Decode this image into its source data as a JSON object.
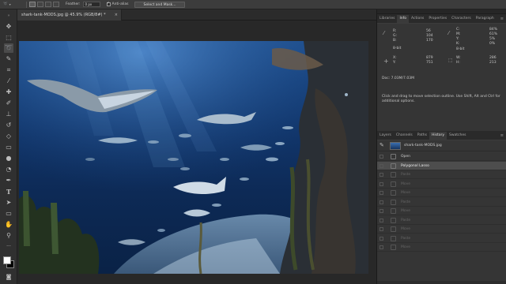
{
  "options_bar": {
    "feather_label": "Feather:",
    "feather_value": "0 px",
    "antialias_label": "Anti-alias",
    "select_mask_label": "Select and Mask..."
  },
  "document": {
    "tab_title": "shark-tank-MODS.jpg @ 45.9% (RGB/8#) *",
    "close_glyph": "×"
  },
  "info_panel": {
    "tabs": [
      "Libraries",
      "Info",
      "Actions",
      "Properties",
      "Characters",
      "Paragraph"
    ],
    "menu_glyph": "≡",
    "rgb_labels": [
      "R:",
      "G:",
      "B:"
    ],
    "rgb_values": [
      "56",
      "104",
      "170"
    ],
    "cmyk_labels": [
      "C:",
      "M:",
      "Y:",
      "K:"
    ],
    "cmyk_values": [
      "84%",
      "61%",
      "5%",
      "0%"
    ],
    "bit_depth_left": "8-bit",
    "bit_depth_right": "8-bit",
    "xy_labels": [
      "X:",
      "Y:"
    ],
    "xy_values": [
      "879",
      "751"
    ],
    "wh_labels": [
      "W:",
      "H:"
    ],
    "wh_values": [
      "286",
      "213"
    ],
    "doc_size": "Doc: 7.03M/7.03M",
    "hint": "Click and drag to move selection outline. Use Shift, Alt and Ctrl for additional options."
  },
  "history_panel": {
    "tabs": [
      "Layers",
      "Channels",
      "Paths",
      "History",
      "Swatches"
    ],
    "menu_glyph": "≡",
    "snapshot_name": "shark-tank-MODS.jpg",
    "states": [
      {
        "label": "Open",
        "status": "normal"
      },
      {
        "label": "Polygonal Lasso",
        "status": "current"
      },
      {
        "label": "Paste",
        "status": "undone"
      },
      {
        "label": "Move",
        "status": "undone"
      },
      {
        "label": "Move",
        "status": "undone"
      },
      {
        "label": "Paste",
        "status": "undone"
      },
      {
        "label": "Move",
        "status": "undone"
      },
      {
        "label": "Paste",
        "status": "undone"
      },
      {
        "label": "Move",
        "status": "undone"
      },
      {
        "label": "Paste",
        "status": "undone"
      },
      {
        "label": "Move",
        "status": "undone"
      }
    ]
  },
  "colors": {
    "foreground": "#ffffff",
    "background": "#000000"
  }
}
